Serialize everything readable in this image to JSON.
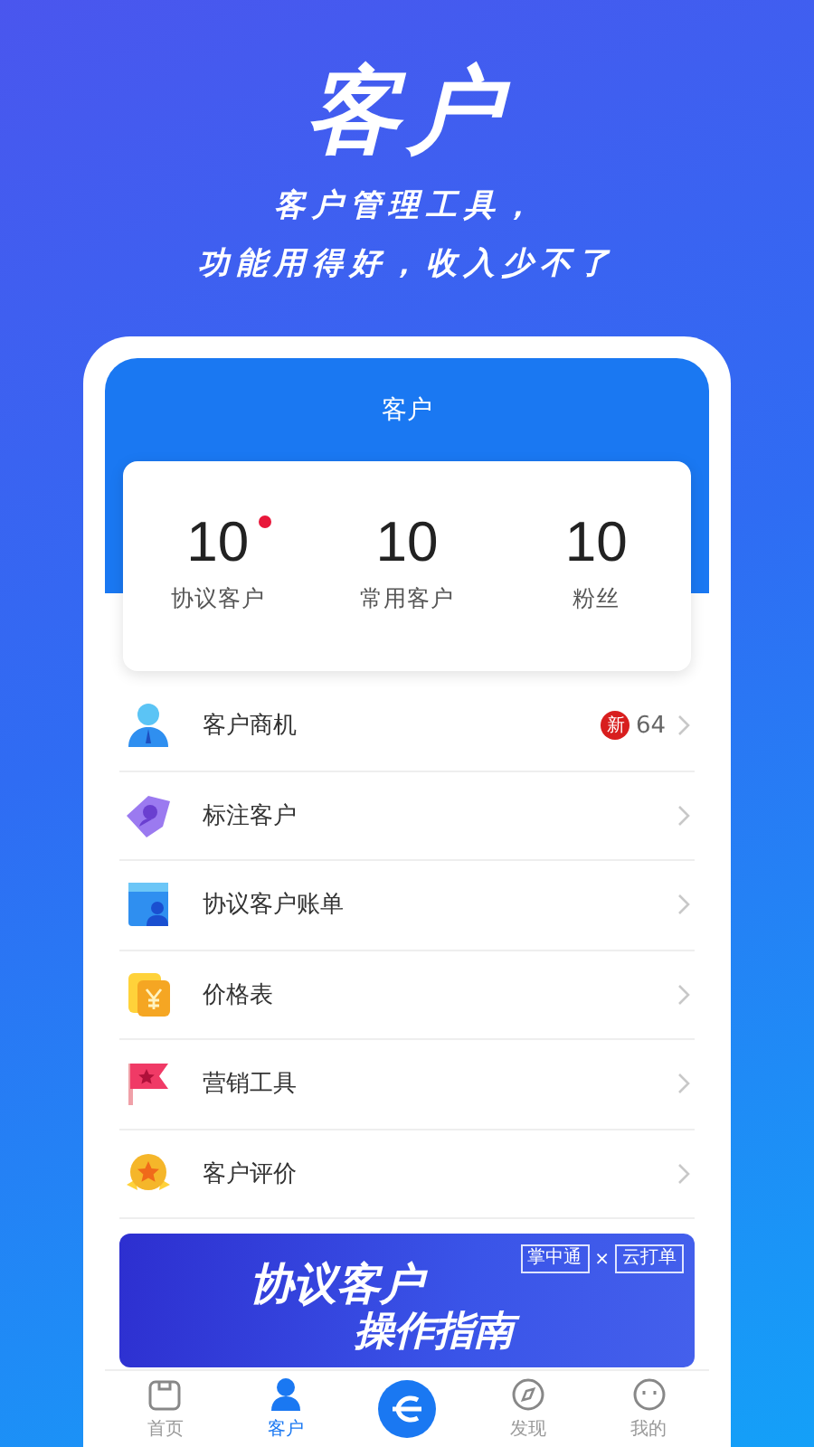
{
  "hero": {
    "title": "客户",
    "subtitle_lines": [
      "客户管理工具，",
      "功能用得好，收入少不了"
    ]
  },
  "screen": {
    "title": "客户"
  },
  "stats": [
    {
      "value": "10",
      "label": "协议客户",
      "dot": true
    },
    {
      "value": "10",
      "label": "常用客户",
      "dot": false
    },
    {
      "value": "10",
      "label": "粉丝",
      "dot": false
    }
  ],
  "menu": [
    {
      "kind": "person",
      "label": "客户商机",
      "badge": "新",
      "count": "64"
    },
    {
      "kind": "tag",
      "label": "标注客户"
    },
    {
      "kind": "bill",
      "label": "协议客户账单"
    },
    {
      "kind": "price",
      "label": "价格表"
    },
    {
      "kind": "flag",
      "label": "营销工具"
    },
    {
      "kind": "medal",
      "label": "客户评价"
    }
  ],
  "banner": {
    "title": "协议客户",
    "subtitle": "操作指南",
    "tags": [
      "掌中通",
      "×",
      "云打单"
    ]
  },
  "tabs": [
    {
      "kind": "home",
      "label": "首页",
      "selected": false
    },
    {
      "kind": "person",
      "label": "客户",
      "selected": true
    },
    {
      "kind": "center",
      "selected": false
    },
    {
      "kind": "compass",
      "label": "发现",
      "selected": false
    },
    {
      "kind": "me",
      "label": "我的",
      "selected": false
    }
  ]
}
